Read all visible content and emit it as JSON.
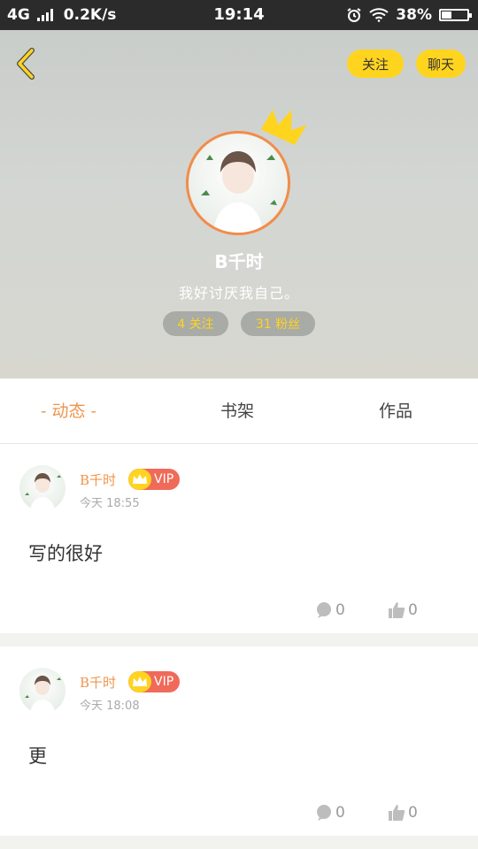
{
  "status_bar": {
    "network": "4G",
    "speed": "0.2K/s",
    "time": "19:14",
    "battery": "38%",
    "battery_level": 0.38
  },
  "header": {
    "follow_label": "关注",
    "chat_label": "聊天"
  },
  "profile": {
    "username": "B千时",
    "bio": "我好讨厌我自己。",
    "following_label": "4 关注",
    "fans_label": "31 粉丝"
  },
  "tabs": [
    {
      "label": "- 动态 -",
      "active": true
    },
    {
      "label": "书架",
      "active": false
    },
    {
      "label": "作品",
      "active": false
    }
  ],
  "posts": [
    {
      "name": "B千时",
      "vip": "VIP",
      "time": "今天 18:55",
      "content": "写的很好",
      "comments": "0",
      "likes": "0"
    },
    {
      "name": "B千时",
      "vip": "VIP",
      "time": "今天 18:08",
      "content": "更",
      "comments": "0",
      "likes": "0"
    }
  ],
  "colors": {
    "accent": "#f0954d",
    "yellow": "#ffd41f",
    "vip_red": "#f06a5a"
  }
}
